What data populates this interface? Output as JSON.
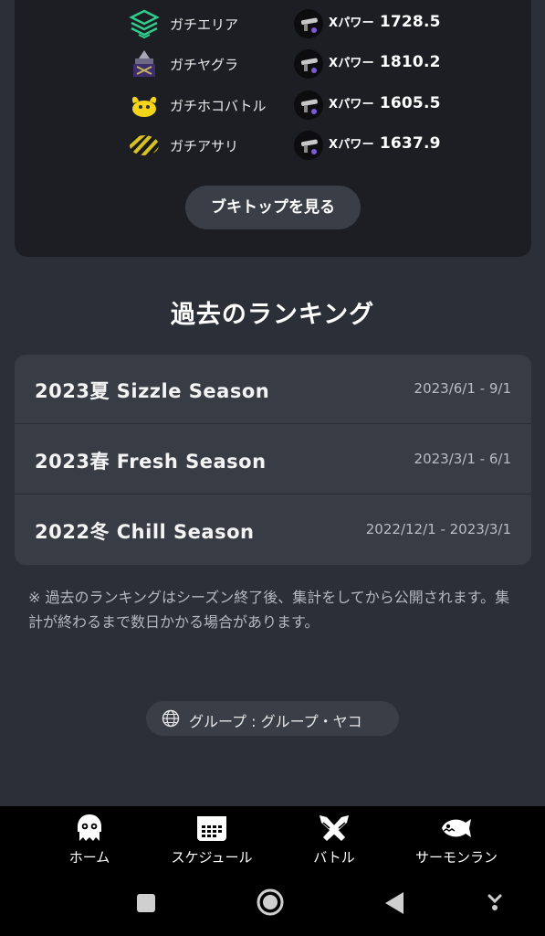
{
  "top_card": {
    "modes": [
      {
        "name": "ガチエリア",
        "xpower_label": "Xパワー",
        "xpower": "1728.5",
        "icon": "splat-zones-icon"
      },
      {
        "name": "ガチヤグラ",
        "xpower_label": "Xパワー",
        "xpower": "1810.2",
        "icon": "tower-control-icon"
      },
      {
        "name": "ガチホコバトル",
        "xpower_label": "Xパワー",
        "xpower": "1605.5",
        "icon": "rainmaker-icon"
      },
      {
        "name": "ガチアサリ",
        "xpower_label": "Xパワー",
        "xpower": "1637.9",
        "icon": "clam-blitz-icon"
      }
    ],
    "buki_button": "ブキトップを見る"
  },
  "past_rankings": {
    "title": "過去のランキング",
    "seasons": [
      {
        "name": "2023夏 Sizzle Season",
        "dates": "2023/6/1 - 9/1"
      },
      {
        "name": "2023春 Fresh Season",
        "dates": "2023/3/1 - 6/1"
      },
      {
        "name": "2022冬 Chill Season",
        "dates": "2022/12/1 - 2023/3/1"
      }
    ],
    "note": "※ 過去のランキングはシーズン終了後、集計をしてから公開されます。集計が終わるまで数日かかる場合があります。"
  },
  "group": {
    "label": "グループ : グループ・ヤコ",
    "icon": "globe-icon"
  },
  "bottom_nav": {
    "items": [
      {
        "label": "ホーム",
        "icon": "squid-home-icon"
      },
      {
        "label": "スケジュール",
        "icon": "calendar-icon"
      },
      {
        "label": "バトル",
        "icon": "battle-icon"
      },
      {
        "label": "サーモンラン",
        "icon": "salmon-icon"
      }
    ]
  },
  "system_bar": {
    "icons": [
      "recents-icon",
      "home-circle-icon",
      "back-icon",
      "keyboard-down-icon"
    ]
  },
  "colors": {
    "background": "#2b2f37",
    "card": "#1c1e23",
    "list_bg": "#383c45",
    "pill_bg": "#3a3e47",
    "zones_green": "#2ecf8c",
    "rainmaker_yellow": "#f5d51a"
  }
}
